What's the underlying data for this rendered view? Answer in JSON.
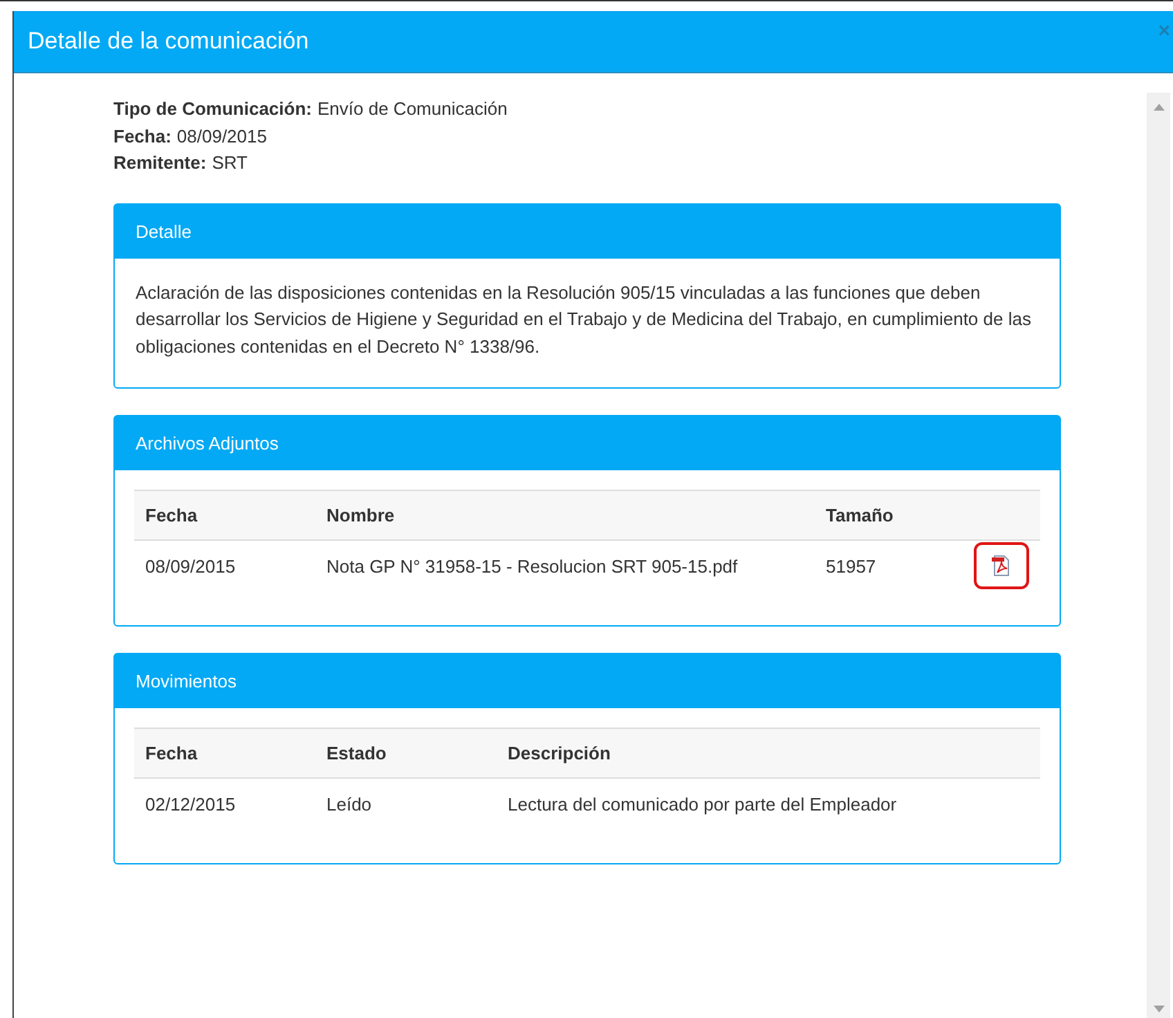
{
  "modal": {
    "title": "Detalle de la comunicación",
    "close": "×"
  },
  "info": [
    {
      "label": "Tipo de Comunicación:",
      "value": "Envío de Comunicación"
    },
    {
      "label": "Fecha:",
      "value": "08/09/2015"
    },
    {
      "label": "Remitente:",
      "value": "SRT"
    }
  ],
  "detail_panel": {
    "title": "Detalle",
    "text": "Aclaración de las disposiciones contenidas en la Resolución 905/15 vinculadas a las funciones que deben desarrollar los Servicios de Higiene y Seguridad en el Trabajo y de Medicina del Trabajo, en cumplimiento de las obligaciones contenidas en el Decreto N° 1338/96."
  },
  "attachments_panel": {
    "title": "Archivos Adjuntos",
    "columns": [
      "Fecha",
      "Nombre",
      "Tamaño"
    ],
    "rows": [
      {
        "date": "08/09/2015",
        "name": "Nota GP N° 31958-15 - Resolucion SRT 905-15.pdf",
        "size": "51957",
        "highlighted": true
      }
    ]
  },
  "movements_panel": {
    "title": "Movimientos",
    "columns": [
      "Fecha",
      "Estado",
      "Descripción"
    ],
    "rows": [
      {
        "date": "02/12/2015",
        "status": "Leído",
        "description": "Lectura del comunicado por parte del Empleador"
      }
    ]
  }
}
